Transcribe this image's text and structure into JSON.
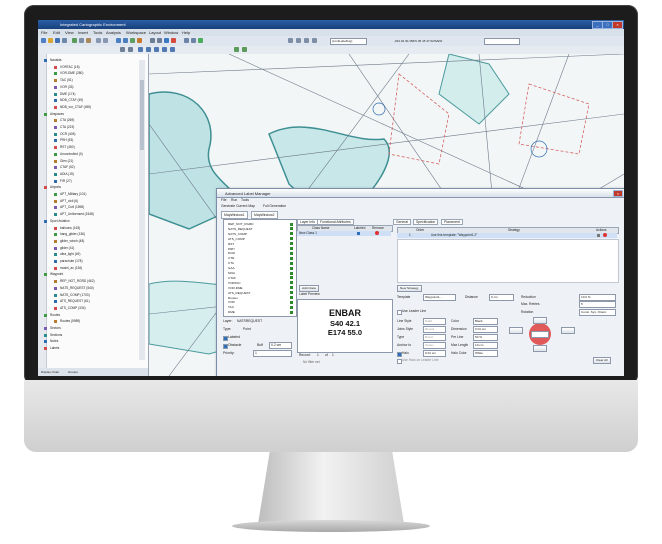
{
  "app": {
    "title": "Integrated Cartographic Environment",
    "menu": [
      "File",
      "Edit",
      "View",
      "Insert",
      "Tools",
      "Analysis",
      "Workspace",
      "Layout",
      "Window",
      "Help"
    ],
    "layer_field": "(LimitLabelling)",
    "coordinate": "-034.04 30.456/S 05 45 47.52/S/EW"
  },
  "layer_tree": {
    "items": [
      "Navaids",
      "VORTAC (18)",
      "VOR-DME (280)",
      "TAC (51)",
      "VOR (33)",
      "DME (174)",
      "NDB_CTAF (49)",
      "NDB_vor_CTAF (455)",
      "Airspaces",
      "CTA (269)",
      "CTA (223)",
      "OCR (405)",
      "PRH (53)",
      "RST (450)",
      "Uncontrolled (0)",
      "Glen (21)",
      "CTAF (52)",
      "ADIA (15)",
      "FIR (27)",
      "Airports",
      "APT_Military (101)",
      "APT_civil (6)",
      "APT_Civil (1598)",
      "APT_Unlicensed (1548)",
      "Sport Aviation",
      "balloons (163)",
      "hang_glider (136)",
      "glider_winch (48)",
      "glider (41)",
      "ultra_light (49)",
      "parachute (178)",
      "model_av (136)",
      "Waypoint",
      "REP_NOT_RGRD (462)",
      "NATS_REQUEST (540)",
      "NATS_COMP (1703)",
      "ATS_REQUEST (61)",
      "ATS_COMP (334)",
      "Routes",
      "Routes (5989)",
      "Sectors",
      "Sections",
      "Notes",
      "Labels"
    ],
    "tabs": [
      "Display Order",
      "Groups"
    ]
  },
  "dialog": {
    "title": "Advanced Label Manager",
    "menu": [
      "File",
      "Run",
      "Tools"
    ],
    "toolbar": [
      "Generate Current Map",
      "Full Generation"
    ],
    "doc_tabs": [
      "MapWindow1",
      "MapWindow2"
    ],
    "class_list": [
      "REP_NOT_RGRD",
      "NATS_REQUEST",
      "NATS_COMP",
      "ATS_COMP",
      "RST",
      "PRH",
      "DGR",
      "CTR",
      "CTA",
      "GAA",
      "MOA",
      "CTAF",
      "VORTAC",
      "VOR-DME",
      "ATS_REQUEST",
      "Routes",
      "VOR",
      "TAC",
      "DME"
    ],
    "layer_label": "Layer:",
    "layer_value": "NATSREQUEST",
    "type_label": "Type:",
    "type_value": "Point",
    "labeled_label": "Labeled",
    "obstacle_label": "Obstacle",
    "buff_label": "Buff",
    "buff_value": "0.2 cm",
    "priority_label": "Priority:",
    "priority_value": "1",
    "layer_tabs": [
      "Layer Info",
      "Functional Attributes"
    ],
    "class_grid": {
      "headers": [
        "Class Name",
        "Labeled",
        "Remove"
      ],
      "row": "New Class 1"
    },
    "add_class": "Add Class",
    "preview_label": "Label Preview",
    "preview_lines": [
      "ENBAR",
      "S40 42.1",
      "E174 55.0"
    ],
    "record": "Record:",
    "record_of": "of",
    "record_cur": "1",
    "record_total": "1",
    "filter": "No filter set",
    "right_tabs": [
      "General",
      "Specification",
      "Placement"
    ],
    "order_headers": [
      "Order",
      "Strategy",
      "Actions"
    ],
    "order_row": [
      "1",
      "Use this template: \"Waypoint1.2\""
    ],
    "new_strategy": "New Strategy",
    "template_label": "Template",
    "template_value": "Waypoint1...",
    "distance_label": "Distance",
    "distance_value": "0 cm",
    "reduction_label": "Reduction",
    "reduction_value": "10.0 %",
    "max_retries_label": "Max. Retries",
    "max_retries_value": "5",
    "rotation_label": "Rotation",
    "rotation_value": "Const. Sys. Orient.",
    "use_leader": "Use Leader Line",
    "line_style": "Line Style",
    "line_style_v": "Solid",
    "joins_style": "Joins Style",
    "joins_style_v": "Round",
    "type2": "Type",
    "type2_v": "Direct",
    "anchor_to": "Anchor to",
    "anchor_to_v": "Vertex",
    "color": "Color",
    "color_v": "Black",
    "dimension": "Dimension",
    "dimension_v": "0.01 cm",
    "per_line": "Per Line",
    "per_line_v": "50 %",
    "max_length": "Max Length",
    "max_length_v": "10 cm",
    "halo": "Halo",
    "halo_v": "0.01 cm",
    "halo_color": "Halo Color",
    "halo_color_v": "White",
    "use_halo": "Use Halo on Leader Line",
    "clear_all": "Clear All"
  }
}
